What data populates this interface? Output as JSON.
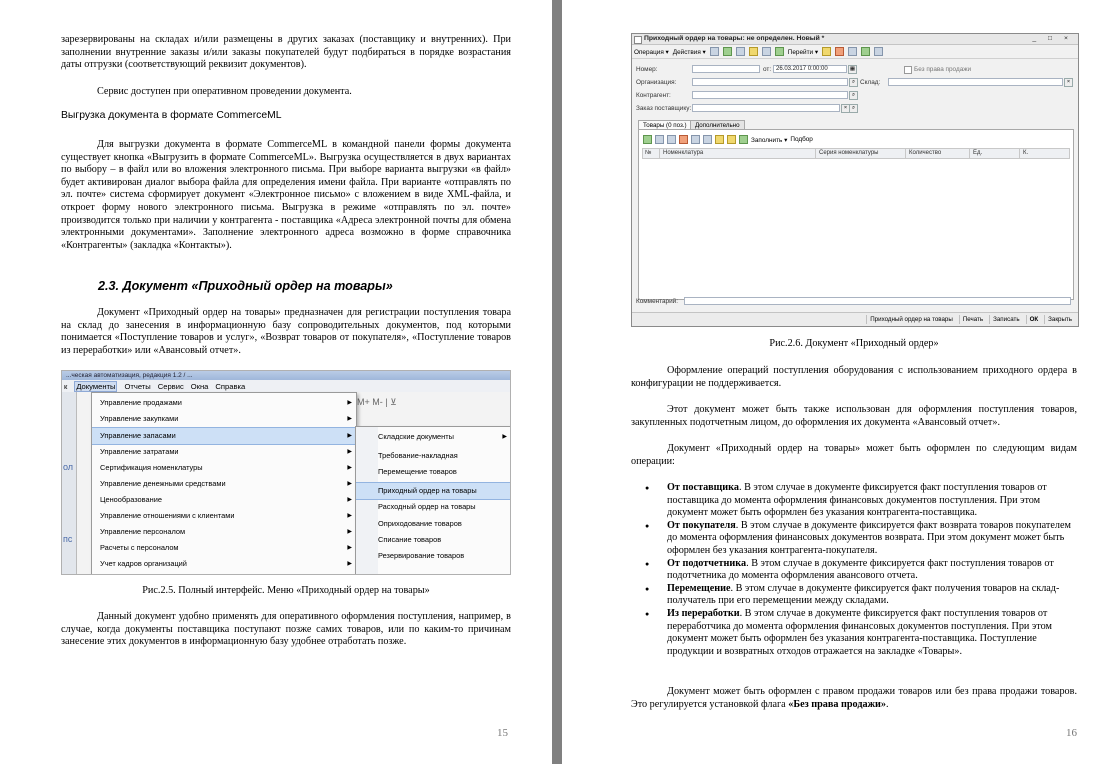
{
  "left_page": {
    "intro_text": "зарезервированы на складах и/или размещены в других заказах (поставщику и внутренних). При заполнении внутренние заказы и/или заказы покупателей будут подбираться в порядке возрастания даты отгрузки (соответствующий реквизит документов).",
    "service_note": "Сервис доступен при оперативном проведении документа.",
    "export_heading": "Выгрузка документа в формате CommerceML",
    "export_paragraph": "Для выгрузки документа в формате CommerceML в командной панели формы документа существует кнопка «Выгрузить в формате CommerceML». Выгрузка осуществляется в двух вариантах по выбору – в файл или во вложения электронного письма. При выборе варианта выгрузки «в файл» будет активирован диалог выбора файла для определения имени файла. При варианте «отправлять по эл. почте» система сформирует документ «Электронное письмо» с вложением в виде XML-файла, и откроет форму нового электронного письма. Выгрузка в режиме «отправлять по эл. почте» производится только при наличии у контрагента - поставщика «Адреса электронной почты для обмена электронными документами». Заполнение электронного адреса возможно в форме справочника «Контрагенты» (закладка «Контакты»).",
    "section_heading": "2.3. Документ «Приходный ордер на товары»",
    "section_paragraph": "Документ «Приходный ордер на товары» предназначен для регистрации поступления товара на склад до занесения в информационную базу сопроводительных документов, под которыми понимается «Поступление товаров и услуг», «Возврат товаров от покупателя», «Поступление товаров из переработки» или «Авансовый отчет».",
    "menu_screenshot": {
      "window_title": "...ческая автоматизация, редакция 1.2 / ...",
      "menubar": [
        "к",
        "Документы",
        "Отчеты",
        "Сервис",
        "Окна",
        "Справка"
      ],
      "toolbar_hint": "М+ М- | ⊻",
      "submenu_1": [
        "Управление продажами",
        "Управление закупками",
        "Управление запасами",
        "Управление затратами",
        "Сертификация номенклатуры",
        "Управление денежными средствами",
        "Ценообразование",
        "Управление отношениями с клиентами",
        "Управление персоналом",
        "Расчеты с персоналом",
        "Учет кадров организаций"
      ],
      "submenu_2": [
        "Складские документы",
        "Требование-накладная",
        "Перемещение товаров",
        "Приходный ордер на товары",
        "Расходный ордер на товары",
        "Оприходование товаров",
        "Списание товаров",
        "Резервирование товаров"
      ],
      "left_strip_glyphs": [
        "ол",
        "пс",
        "е"
      ]
    },
    "caption": "Рис.2.5. Полный интерфейс. Меню «Приходный ордер на товары»",
    "closing_paragraph": "Данный документ удобно применять для оперативного оформления поступления, например, в случае, когда документы поставщика поступают позже самих товаров, или по каким-то причинам занесение этих документов в информационную базу удобнее отработать позже.",
    "page_number": "15"
  },
  "right_page": {
    "form_screenshot": {
      "title": "Приходный ордер на товары: не определен. Новый *",
      "window_controls": "_ □ ×",
      "toolbar": [
        "Операция ▾",
        "Действия ▾",
        "Перейти ▾"
      ],
      "labels": {
        "number": "Номер:",
        "date_from": "от:",
        "date_value": "26.03.2017 0:00:00",
        "no_sale_right": "Без права продажи",
        "organization": "Организация:",
        "warehouse": "Склад:",
        "contractor": "Контрагент:",
        "supplier_order": "Заказ поставщику:",
        "comment": "Комментарий:"
      },
      "tabs": [
        "Товары (0 поз.)",
        "Дополнительно"
      ],
      "table_toolbar": [
        "Заполнить ▾",
        "Подбор"
      ],
      "columns": [
        "№",
        "Номенклатура",
        "Серия номенклатуры",
        "Количество",
        "Ед.",
        "К."
      ],
      "bottom_buttons": [
        "Приходный ордер на товары",
        "Печать",
        "Записать",
        "ОК",
        "Закрыть"
      ]
    },
    "caption": "Рис.2.6. Документ «Приходный ордер»",
    "para_1": "Оформление операций поступления оборудования с использованием приходного ордера в конфигурации не поддерживается.",
    "para_2": "Этот документ может быть также использован для оформления поступления товаров, закупленных подотчетным лицом, до оформления их документа «Авансовый отчет».",
    "para_3": "Документ «Приходный ордер на товары» может быть оформлен по следующим видам операции:",
    "operations": [
      {
        "term": "От поставщика",
        "text": ". В этом случае в документе фиксируется факт поступления товаров от поставщика до момента оформления финансовых документов поступления. При этом документ может быть оформлен без указания контрагента-поставщика."
      },
      {
        "term": "От покупателя",
        "text": ". В этом случае в документе фиксируется факт возврата товаров покупателем до момента оформления финансовых документов возврата. При этом документ может быть оформлен без указания контрагента-покупателя."
      },
      {
        "term": "От подотчетника",
        "text": ". В этом случае в документе фиксируется факт поступления товаров от подотчетника до момента оформления авансового отчета."
      },
      {
        "term": "Перемещение",
        "text": ". В этом случае в документе фиксируется факт получения товаров на склад-получатель при его перемещении между складами."
      },
      {
        "term": "Из переработки",
        "text": ". В этом случае в документе фиксируется факт поступления товаров от переработчика до момента оформления финансовых документов поступления. При этом документ может быть оформлен без указания контрагента-поставщика. Поступление продукции и возвратных отходов отражается на закладке «Товары»."
      }
    ],
    "final_text_prefix": "Документ может быть оформлен с правом продажи товаров или без права продажи товаров. Это регулируется установкой флага ",
    "final_text_flag": "«Без права продажи»",
    "final_text_suffix": ".",
    "page_number": "16"
  }
}
